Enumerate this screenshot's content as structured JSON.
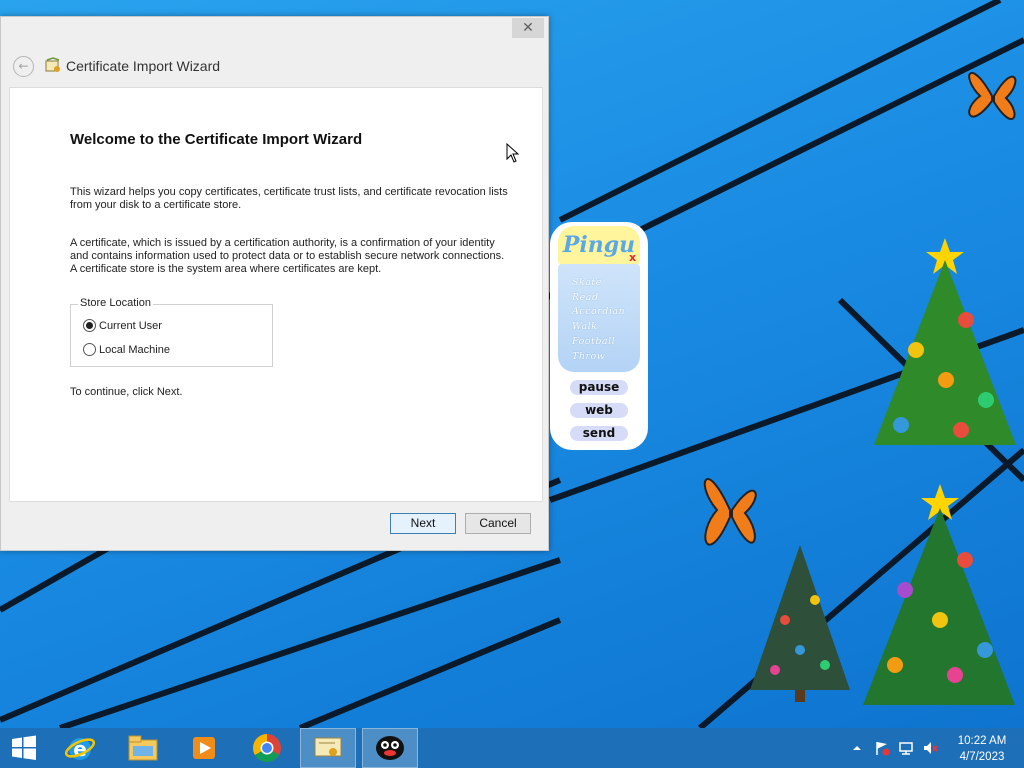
{
  "wizard": {
    "title": "Certificate Import Wizard",
    "close_label": "✕",
    "back_label": "←",
    "heading": "Welcome to the Certificate Import Wizard",
    "paragraph1": "This wizard helps you copy certificates, certificate trust lists, and certificate revocation lists from your disk to a certificate store.",
    "paragraph2": "A certificate, which is issued by a certification authority, is a confirmation of your identity and contains information used to protect data or to establish secure network connections. A certificate store is the system area where certificates are kept.",
    "store_location": {
      "legend": "Store Location",
      "options": [
        {
          "label": "Current User",
          "selected": true
        },
        {
          "label": "Local Machine",
          "selected": false
        }
      ]
    },
    "continue_text": "To continue, click Next.",
    "next_label": "Next",
    "cancel_label": "Cancel"
  },
  "pingu_widget": {
    "logo": "Pingu",
    "close": "x",
    "menu_items": [
      "Skate",
      "Read",
      "Accordian",
      "Walk",
      "Football",
      "Throw"
    ],
    "buttons": [
      "pause",
      "web",
      "send"
    ]
  },
  "taskbar": {
    "start_icon": "windows-logo-icon",
    "pinned": [
      {
        "name": "internet-explorer-icon"
      },
      {
        "name": "file-explorer-icon"
      },
      {
        "name": "media-player-icon"
      },
      {
        "name": "chrome-icon"
      },
      {
        "name": "certificate-icon"
      },
      {
        "name": "pingu-icon"
      }
    ],
    "clock": {
      "time": "10:22 AM",
      "date": "4/7/2023"
    }
  },
  "colors": {
    "desktop": "#1a8ce3",
    "taskbar": "#1d6fb8",
    "accent": "#3c7fb1"
  }
}
